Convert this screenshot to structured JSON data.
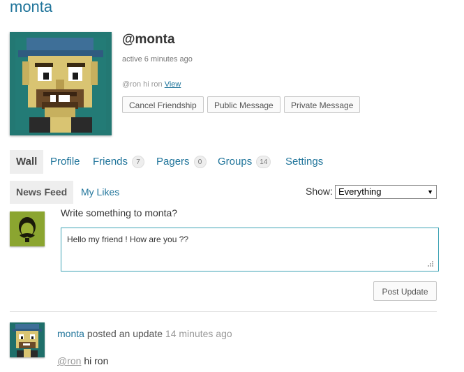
{
  "site": {
    "title": "monta"
  },
  "profile": {
    "handle": "@monta",
    "active": "active 6 minutes ago",
    "latest_update": {
      "text": "@ron hi ron",
      "link": "View"
    },
    "buttons": {
      "cancel_friendship": "Cancel Friendship",
      "public_message": "Public Message",
      "private_message": "Private Message"
    }
  },
  "nav": {
    "items": [
      {
        "label": "Wall",
        "active": true
      },
      {
        "label": "Profile"
      },
      {
        "label": "Friends",
        "count": "7"
      },
      {
        "label": "Pagers",
        "count": "0"
      },
      {
        "label": "Groups",
        "count": "14"
      },
      {
        "label": "Settings"
      }
    ]
  },
  "subnav": {
    "items": [
      {
        "label": "News Feed",
        "active": true
      },
      {
        "label": "My Likes"
      }
    ],
    "show_label": "Show:",
    "show_value": "Everything"
  },
  "post_form": {
    "prompt": "Write something to monta?",
    "value": "Hello my friend ! How are you ??",
    "submit": "Post Update"
  },
  "activity": [
    {
      "author": "monta",
      "verb": "posted an update",
      "time": "14 minutes ago",
      "mention": "@ron",
      "text": "hi ron"
    }
  ],
  "colors": {
    "link": "#21759b",
    "tab_active_bg": "#eeeeee",
    "textarea_border": "#3ea3b5",
    "avatar_bg": "#1f6f6a",
    "small_avatar_bg": "#7e9b2a"
  },
  "icons": {
    "member_avatar": "pixel-art-face",
    "user_avatar": "mustache-face",
    "dropdown": "triangle-down",
    "resize": "resize-grip-icon"
  }
}
